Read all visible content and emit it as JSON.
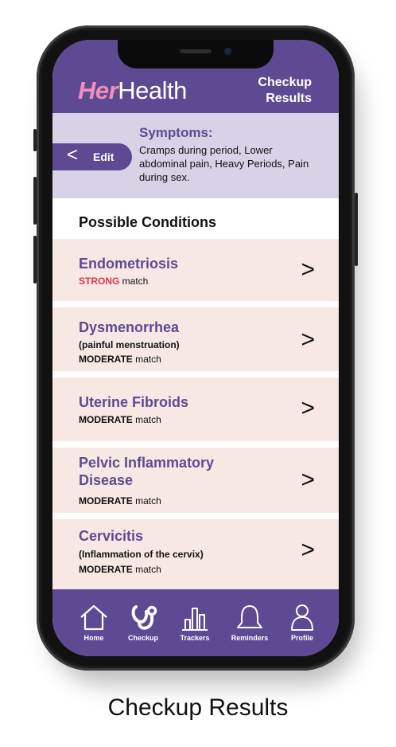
{
  "app": {
    "brand_accent": "Her",
    "brand_rest": "Health",
    "screen_title": "Checkup Results",
    "colors": {
      "primary": "#5e4a93",
      "brand_pink": "#f08fb8",
      "strong": "#d9394f",
      "card": "#f7e8e4",
      "symptoms_bg": "#d8d2e7"
    }
  },
  "symptoms": {
    "edit_label": "Edit",
    "title": "Symptoms:",
    "text": "Cramps during period, Lower abdominal pain, Heavy Periods, Pain during sex."
  },
  "conditions": {
    "heading": "Possible Conditions",
    "items": [
      {
        "name": "Endometriosis",
        "subtitle": "",
        "level": "STRONG",
        "suffix": " match",
        "arrow": ">"
      },
      {
        "name": "Dysmenorrhea",
        "subtitle": "(painful menstruation)",
        "level": "MODERATE",
        "suffix": " match",
        "arrow": ">"
      },
      {
        "name": "Uterine Fibroids",
        "subtitle": "",
        "level": "MODERATE",
        "suffix": " match",
        "arrow": ">"
      },
      {
        "name": "Pelvic Inflammatory Disease",
        "subtitle": "",
        "level": "MODERATE",
        "suffix": " match",
        "arrow": ">"
      },
      {
        "name": "Cervicitis",
        "subtitle": "(Inflammation of the cervix)",
        "level": "MODERATE",
        "suffix": " match",
        "arrow": ">"
      }
    ]
  },
  "nav": {
    "items": [
      {
        "label": "Home",
        "icon": "home-icon"
      },
      {
        "label": "Checkup",
        "icon": "stethoscope-icon"
      },
      {
        "label": "Trackers",
        "icon": "bar-chart-icon"
      },
      {
        "label": "Reminders",
        "icon": "bell-icon"
      },
      {
        "label": "Profile",
        "icon": "person-icon"
      }
    ]
  },
  "caption": "Checkup Results"
}
